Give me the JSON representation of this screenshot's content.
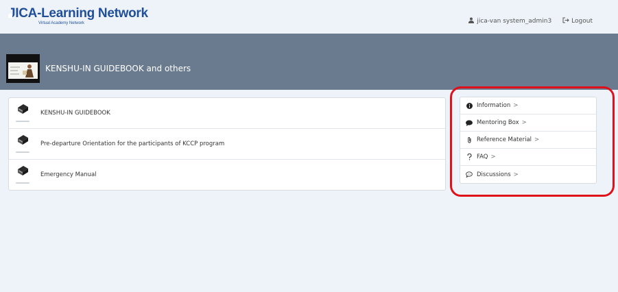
{
  "header": {
    "logo_title": "JICA-Learning Network",
    "logo_subtitle": "Virtual Academy Network",
    "username": "jica-van system_admin3",
    "logout_label": "Logout"
  },
  "banner": {
    "title": "KENSHU-IN GUIDEBOOK and others"
  },
  "main": {
    "items": [
      {
        "label": "KENSHU-IN GUIDEBOOK"
      },
      {
        "label": "Pre-departure Orientation for the participants of KCCP program"
      },
      {
        "label": "Emergency Manual"
      }
    ]
  },
  "sidebar": {
    "items": [
      {
        "label": "Information",
        "icon": "info-circle-icon",
        "chevron": ">"
      },
      {
        "label": "Mentoring Box",
        "icon": "comment-icon",
        "chevron": ">"
      },
      {
        "label": "Reference Material",
        "icon": "paperclip-icon",
        "chevron": ">"
      },
      {
        "label": "FAQ",
        "icon": "question-icon",
        "chevron": ">"
      },
      {
        "label": "Discussions",
        "icon": "chat-bubble-icon",
        "chevron": ">"
      }
    ]
  },
  "colors": {
    "banner": "#6b7b8f",
    "logo": "#1f4f9a",
    "highlight": "#e0101a",
    "background": "#eef3fa"
  }
}
